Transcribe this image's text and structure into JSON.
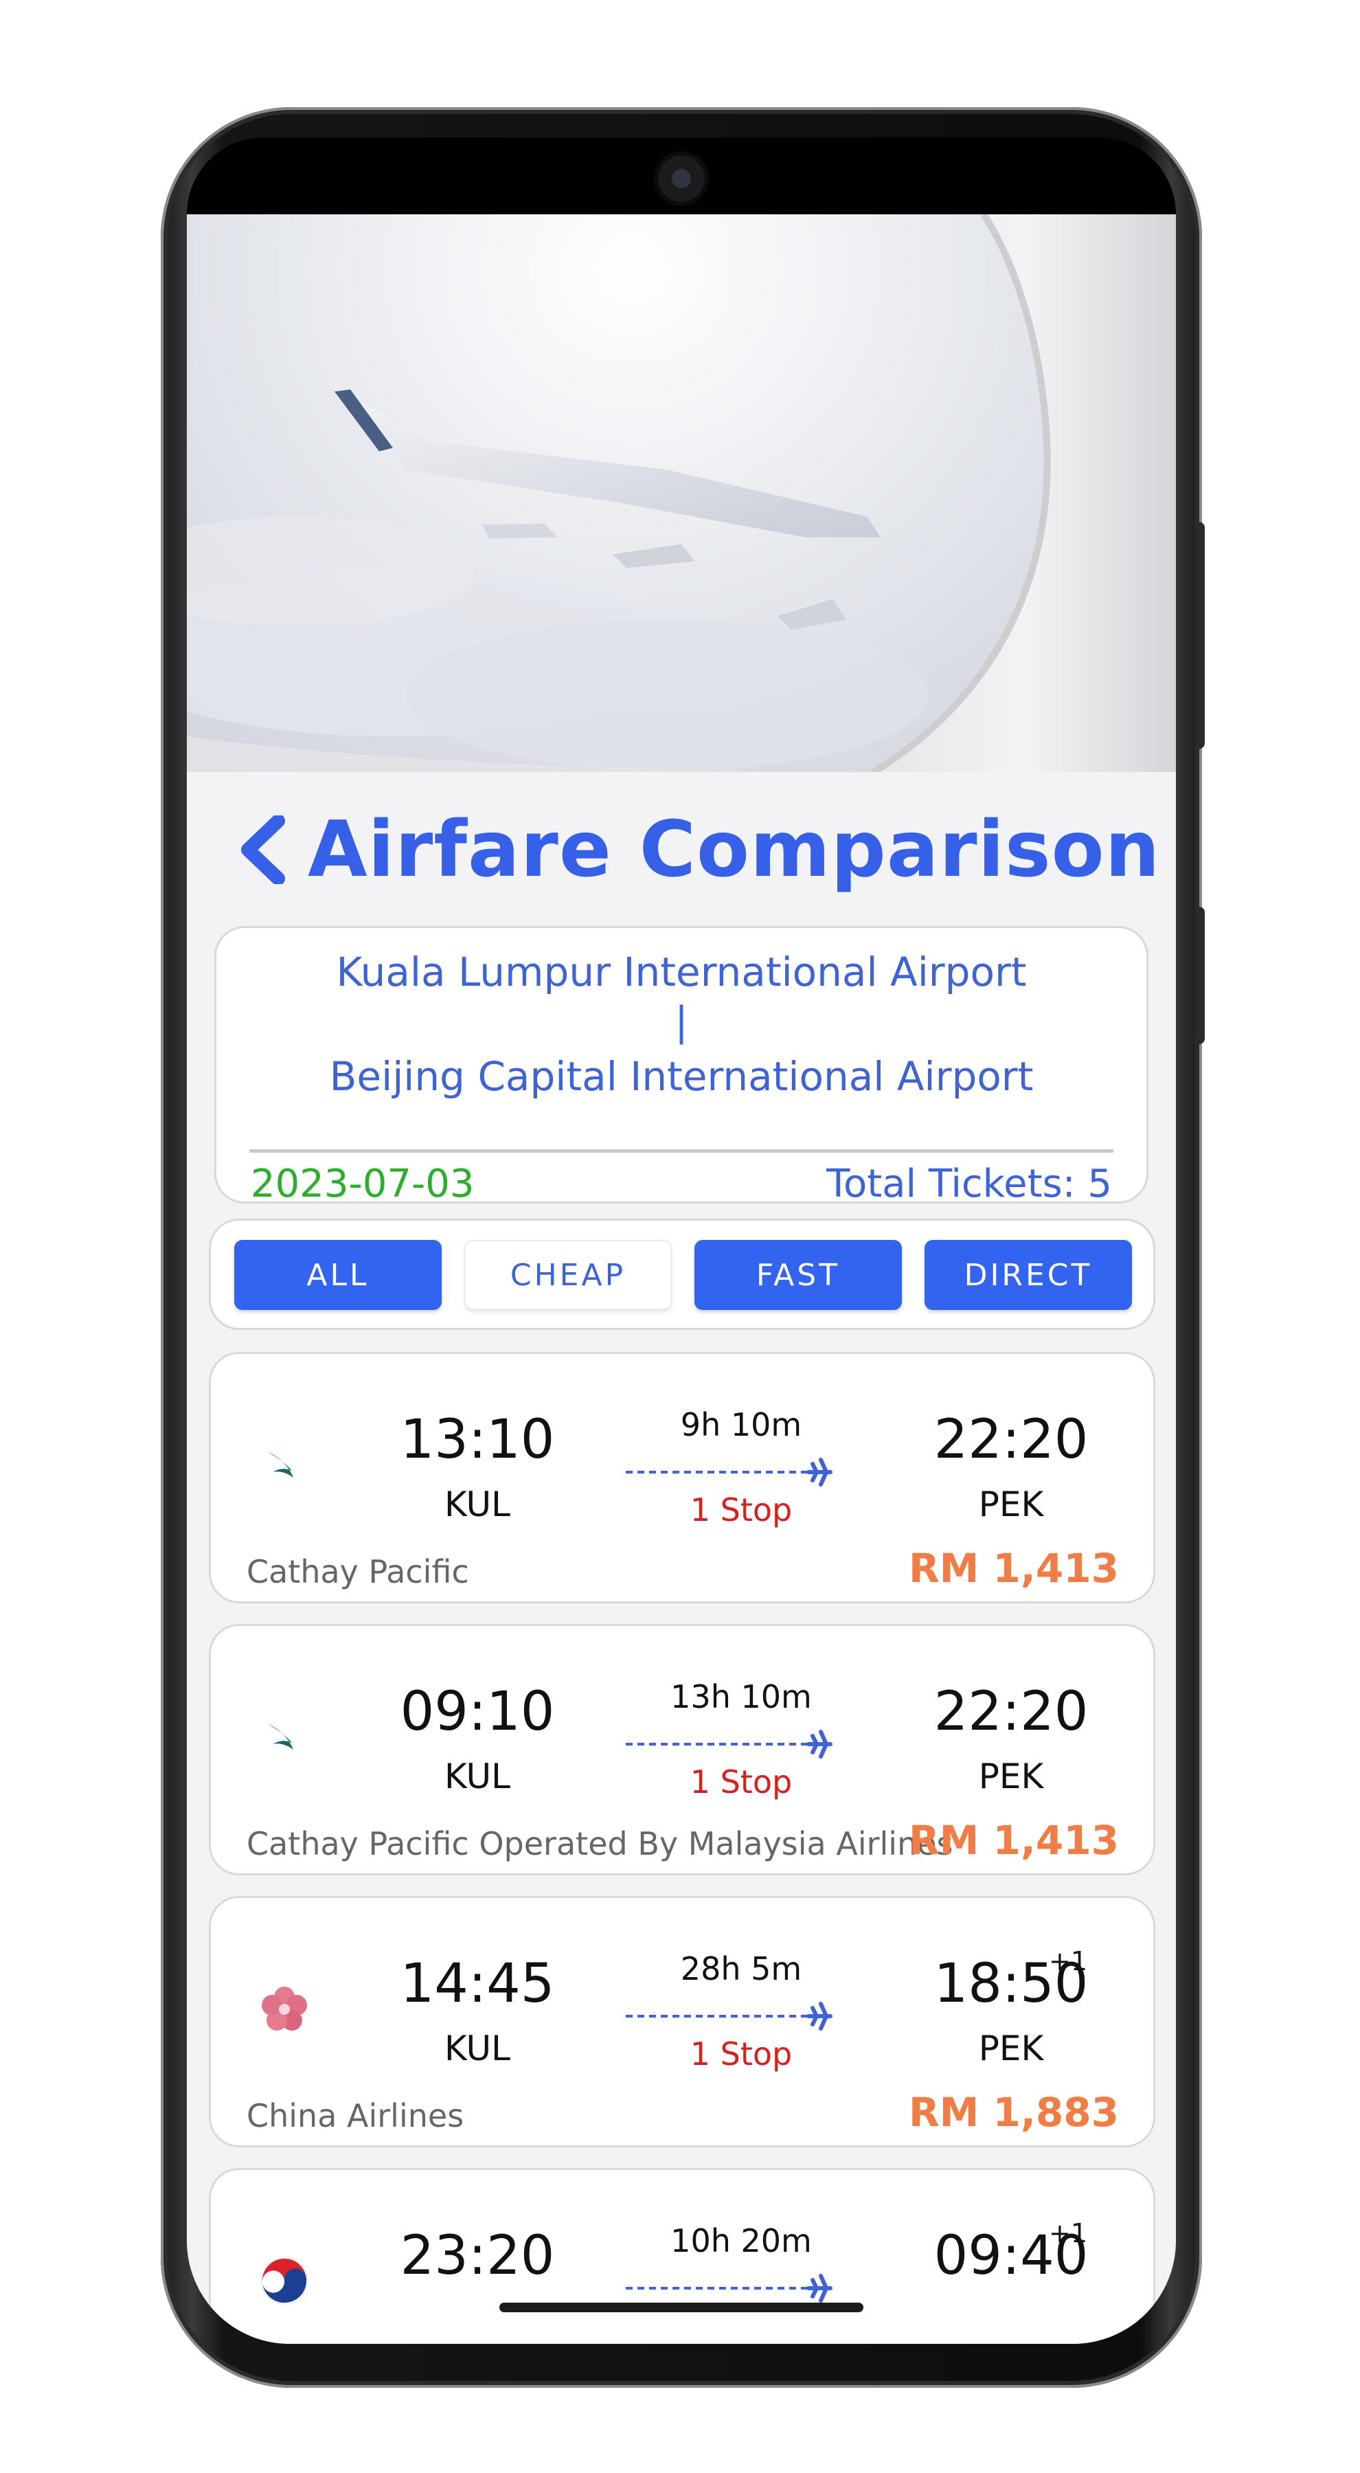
{
  "header": {
    "title": "Airfare Comparison"
  },
  "route": {
    "origin": "Kuala Lumpur International Airport",
    "separator": "|",
    "destination": "Beijing Capital International Airport",
    "date": "2023-07-03",
    "total_tickets": "Total Tickets: 5"
  },
  "filters": [
    {
      "label": "ALL",
      "active": true
    },
    {
      "label": "CHEAP",
      "active": false
    },
    {
      "label": "FAST",
      "active": true
    },
    {
      "label": "DIRECT",
      "active": true
    }
  ],
  "flights": [
    {
      "airline": "Cathay Pacific",
      "logo": "cathay-pacific-logo",
      "dep_time": "13:10",
      "dep_code": "KUL",
      "duration": "9h 10m",
      "stops": "1 Stop",
      "arr_time": "22:20",
      "arr_code": "PEK",
      "next_day": "",
      "price": "RM 1,413"
    },
    {
      "airline": "Cathay Pacific Operated By Malaysia Airlines",
      "logo": "cathay-pacific-logo",
      "dep_time": "09:10",
      "dep_code": "KUL",
      "duration": "13h 10m",
      "stops": "1 Stop",
      "arr_time": "22:20",
      "arr_code": "PEK",
      "next_day": "",
      "price": "RM 1,413"
    },
    {
      "airline": "China Airlines",
      "logo": "china-airlines-logo",
      "dep_time": "14:45",
      "dep_code": "KUL",
      "duration": "28h 5m",
      "stops": "1 Stop",
      "arr_time": "18:50",
      "arr_code": "PEK",
      "next_day": "+1",
      "price": "RM 1,883"
    },
    {
      "airline": "",
      "logo": "korean-air-logo",
      "dep_time": "23:20",
      "dep_code": "",
      "duration": "10h 20m",
      "stops": "",
      "arr_time": "09:40",
      "arr_code": "",
      "next_day": "+1",
      "price": ""
    }
  ],
  "colors": {
    "accent": "#3364f0",
    "route_text": "#3e63d6",
    "date": "#2cae2c",
    "stop": "#d7201e",
    "price": "#f07d45"
  }
}
